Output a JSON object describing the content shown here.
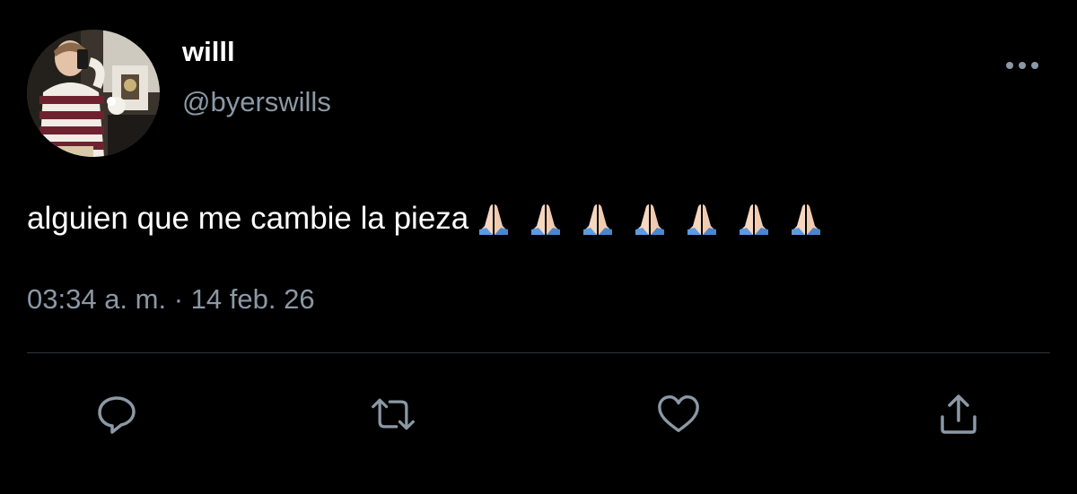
{
  "tweet": {
    "display_name": "willl",
    "handle": "@byerswills",
    "text": "alguien que me cambie la pieza",
    "emoji": [
      "folded-hands-icon",
      "folded-hands-icon",
      "folded-hands-icon",
      "folded-hands-icon",
      "folded-hands-icon",
      "folded-hands-icon",
      "folded-hands-icon"
    ],
    "time": "03:34 a. m.",
    "separator": "·",
    "date": "14 feb. 26"
  },
  "actions": {
    "reply": "reply-icon",
    "retweet": "retweet-icon",
    "like": "heart-icon",
    "share": "share-icon"
  },
  "colors": {
    "background": "#000000",
    "primary_text": "#ffffff",
    "secondary_text": "#8b98a5",
    "divider": "#2f3336",
    "icon": "#8b98a5"
  }
}
